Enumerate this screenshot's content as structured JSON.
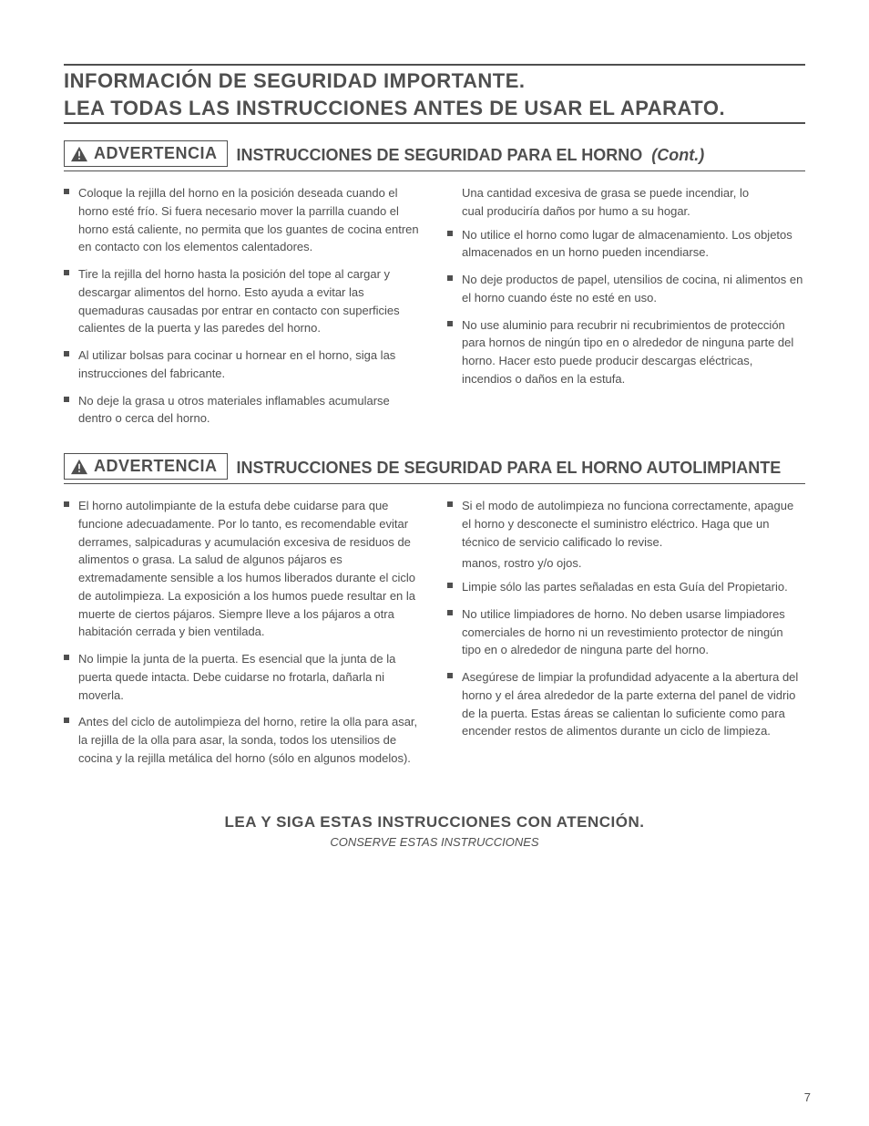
{
  "page": {
    "main_title": "INFORMACIÓN DE SEGURIDAD IMPORTANTE.",
    "subtitle": "LEA TODAS LAS INSTRUCCIONES ANTES DE USAR EL APARATO.",
    "footer_main": "LEA Y SIGA ESTAS INSTRUCCIONES CON ATENCIÓN.",
    "footer_sub": "CONSERVE ESTAS INSTRUCCIONES",
    "page_number": "7"
  },
  "section1": {
    "warn_label": "ADVERTENCIA",
    "heading_a": "INSTRUCCIONES DE SEGURIDAD PARA EL HORNO",
    "heading_b": "(Cont.)",
    "left": [
      "Coloque la rejilla del horno en la posición deseada cuando el horno esté frío. Si fuera necesario mover la parrilla cuando el horno está caliente, no permita que los guantes de cocina entren en contacto con los elementos calentadores.",
      "Tire la rejilla del horno hasta la posición del tope al cargar y descargar alimentos del horno. Esto ayuda a evitar las quemaduras causadas por entrar en contacto con superficies calientes de la puerta y las paredes del horno.",
      "Al utilizar bolsas para cocinar u hornear en el horno, siga las instrucciones del fabricante.",
      "No deje la grasa u otros materiales inflamables acumularse dentro o cerca del horno."
    ],
    "right_lines": {
      "r1": "Una cantidad excesiva de grasa se puede incendiar, lo",
      "r2": "cual produciría daños por humo a su hogar."
    },
    "right": [
      "No utilice el horno como lugar de almacenamiento. Los objetos almacenados en un horno pueden incendiarse.",
      "No deje productos de papel, utensilios de cocina, ni alimentos en el horno cuando éste no esté en uso.",
      "No use aluminio para recubrir ni recubrimientos de protección para hornos de ningún tipo en o alrededor de ninguna parte del horno. Hacer esto puede producir descargas eléctricas, incendios o daños en la estufa."
    ]
  },
  "section2": {
    "warn_label": "ADVERTENCIA",
    "heading_a": "INSTRUCCIONES DE SEGURIDAD PARA EL HORNO AUTOLIMPIANTE",
    "left": [
      "El horno autolimpiante de la estufa debe cuidarse para que funcione adecuadamente. Por lo tanto, es recomendable evitar derrames, salpicaduras y acumulación excesiva de residuos de alimentos o grasa. La salud de algunos pájaros es extremadamente sensible a los humos liberados durante el ciclo de autolimpieza. La exposición a los humos puede resultar en la muerte de ciertos pájaros. Siempre lleve a los pájaros a otra habitación cerrada y bien ventilada.",
      "No limpie la junta de la puerta. Es esencial que la junta de la puerta quede intacta. Debe cuidarse no frotarla, dañarla ni moverla.",
      "Antes del ciclo de autolimpieza del horno, retire la olla para asar, la rejilla de la olla para asar, la sonda, todos los utensilios de cocina y la rejilla metálica del horno (sólo en algunos modelos)."
    ],
    "right": [
      "Si el modo de autolimpieza no funciona correctamente, apague el horno y desconecte el suministro eléctrico. Haga que un técnico de servicio calificado lo revise.",
      "Limpie sólo las partes señaladas en esta Guía del Propietario.",
      "No utilice limpiadores de horno. No deben usarse limpiadores comerciales de horno ni un revestimiento protector de ningún tipo en o alrededor de ninguna parte del horno.",
      "Asegúrese de limpiar la profundidad adyacente a la abertura del horno y el área alrededor de la parte externa del panel de vidrio de la puerta. Estas áreas se calientan lo suficiente como para encender restos de alimentos durante un ciclo de limpieza."
    ],
    "right_top_lines": {
      "t1": "manos, rostro y/o ojos."
    }
  }
}
